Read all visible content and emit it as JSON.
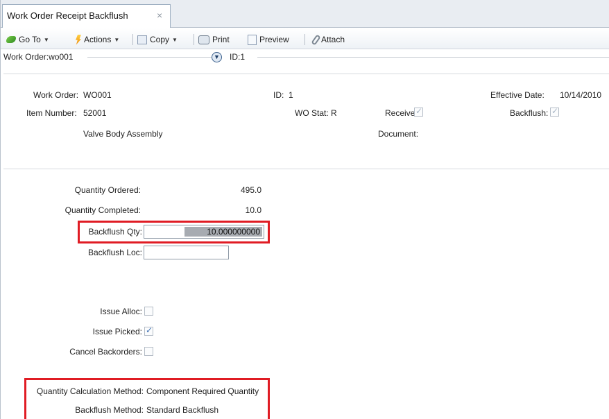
{
  "tab": {
    "title": "Work Order Receipt Backflush",
    "close": "×"
  },
  "toolbar": {
    "goto": "Go To",
    "actions": "Actions",
    "copy": "Copy",
    "print": "Print",
    "preview": "Preview",
    "attach": "Attach"
  },
  "record_bar": {
    "work_order": "Work Order:wo001",
    "id": "ID:1"
  },
  "header": {
    "work_order_label": "Work Order:",
    "work_order_value": "WO001",
    "id_label": "ID:",
    "id_value": "1",
    "effective_date_label": "Effective Date:",
    "effective_date_value": "10/14/2010",
    "item_number_label": "Item Number:",
    "item_number_value": "52001",
    "wo_stat_label": "WO Stat:",
    "wo_stat_value": "R",
    "receive_label": "Receive:",
    "receive_checked": true,
    "backflush_label": "Backflush:",
    "backflush_checked": true,
    "item_description": "Valve Body Assembly",
    "document_label": "Document:"
  },
  "quantities": {
    "ordered_label": "Quantity Ordered:",
    "ordered_value": "495.0",
    "completed_label": "Quantity Completed:",
    "completed_value": "10.0",
    "backflush_qty_label": "Backflush Qty:",
    "backflush_qty_value": "10.000000000",
    "backflush_loc_label": "Backflush Loc:",
    "backflush_loc_value": ""
  },
  "options": {
    "issue_alloc_label": "Issue Alloc:",
    "issue_alloc_checked": false,
    "issue_picked_label": "Issue Picked:",
    "issue_picked_checked": true,
    "cancel_backorders_label": "Cancel Backorders:",
    "cancel_backorders_checked": false
  },
  "methods": {
    "qty_calc_label": "Quantity Calculation Method:",
    "qty_calc_value": "Component Required Quantity",
    "backflush_method_label": "Backflush Method:",
    "backflush_method_value": "Standard Backflush"
  },
  "colors": {
    "highlight": "#e01c24",
    "check": "#3d6fb3"
  }
}
